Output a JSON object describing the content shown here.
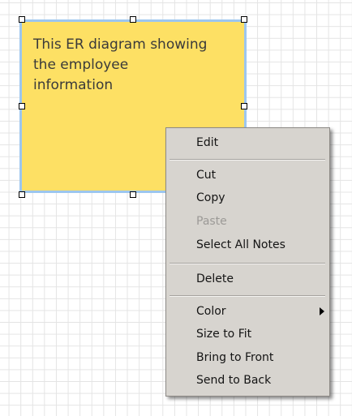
{
  "note": {
    "text": "This ER diagram showing\nthe employee\ninformation",
    "background_color": "#fde064",
    "selection_color": "#9cc6ef"
  },
  "context_menu": {
    "edit": "Edit",
    "cut": "Cut",
    "copy": "Copy",
    "paste": "Paste",
    "select_all_notes": "Select All Notes",
    "delete": "Delete",
    "color": "Color",
    "size_to_fit": "Size to Fit",
    "bring_to_front": "Bring to Front",
    "send_to_back": "Send to Back",
    "color_submenu_icon": "triangle-right-icon"
  }
}
